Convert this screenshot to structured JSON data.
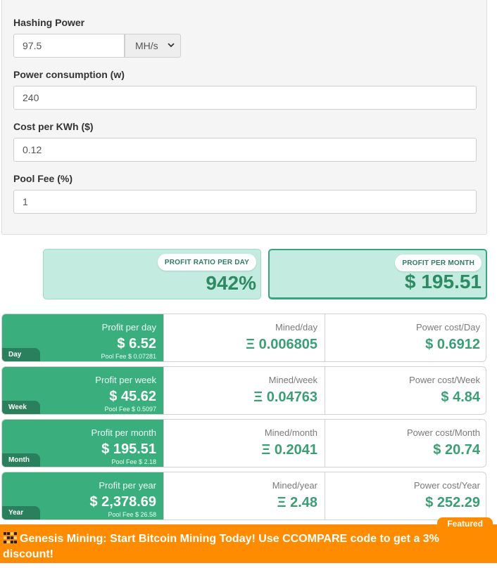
{
  "form": {
    "hashing_power_label": "Hashing Power",
    "hashing_power_value": "97.5",
    "hashing_unit": "MH/s",
    "power_consumption_label": "Power consumption (w)",
    "power_consumption_value": "240",
    "cost_per_kwh_label": "Cost per KWh ($)",
    "cost_per_kwh_value": "0.12",
    "pool_fee_label": "Pool Fee (%)",
    "pool_fee_value": "1"
  },
  "summary": {
    "ratio_label": "PROFIT RATIO PER DAY",
    "ratio_value": "942%",
    "month_label": "PROFIT PER MONTH",
    "month_value": "$ 195.51"
  },
  "periods": [
    {
      "tag": "Day",
      "profit_label": "Profit per day",
      "profit_value": "$ 6.52",
      "pool_fee": "Pool Fee $ 0.07281",
      "mined_label": "Mined/day",
      "mined_value": "Ξ 0.006805",
      "power_label": "Power cost/Day",
      "power_value": "$ 0.6912"
    },
    {
      "tag": "Week",
      "profit_label": "Profit per week",
      "profit_value": "$ 45.62",
      "pool_fee": "Pool Fee $ 0.5097",
      "mined_label": "Mined/week",
      "mined_value": "Ξ 0.04763",
      "power_label": "Power cost/Week",
      "power_value": "$ 4.84"
    },
    {
      "tag": "Month",
      "profit_label": "Profit per month",
      "profit_value": "$ 195.51",
      "pool_fee": "Pool Fee $ 2.18",
      "mined_label": "Mined/month",
      "mined_value": "Ξ 0.2041",
      "power_label": "Power cost/Month",
      "power_value": "$ 20.74"
    },
    {
      "tag": "Year",
      "profit_label": "Profit per year",
      "profit_value": "$ 2,378.69",
      "pool_fee": "Pool Fee $ 26.58",
      "mined_label": "Mined/year",
      "mined_value": "Ξ 2.48",
      "power_label": "Power cost/Year",
      "power_value": "$ 252.29"
    }
  ],
  "banner": {
    "featured_label": "Featured",
    "text": "Genesis Mining: Start Bitcoin Mining Today! Use CCOMPARE code to get a 3% discount!",
    "icon": "genesis-logo-icon"
  },
  "colors": {
    "accent_green": "#3aaf7d",
    "dark_green": "#2a7f5c",
    "value_green": "#3a9f75",
    "summary_bg": "#c3ebdf",
    "banner_orange": "#ff8c00"
  }
}
